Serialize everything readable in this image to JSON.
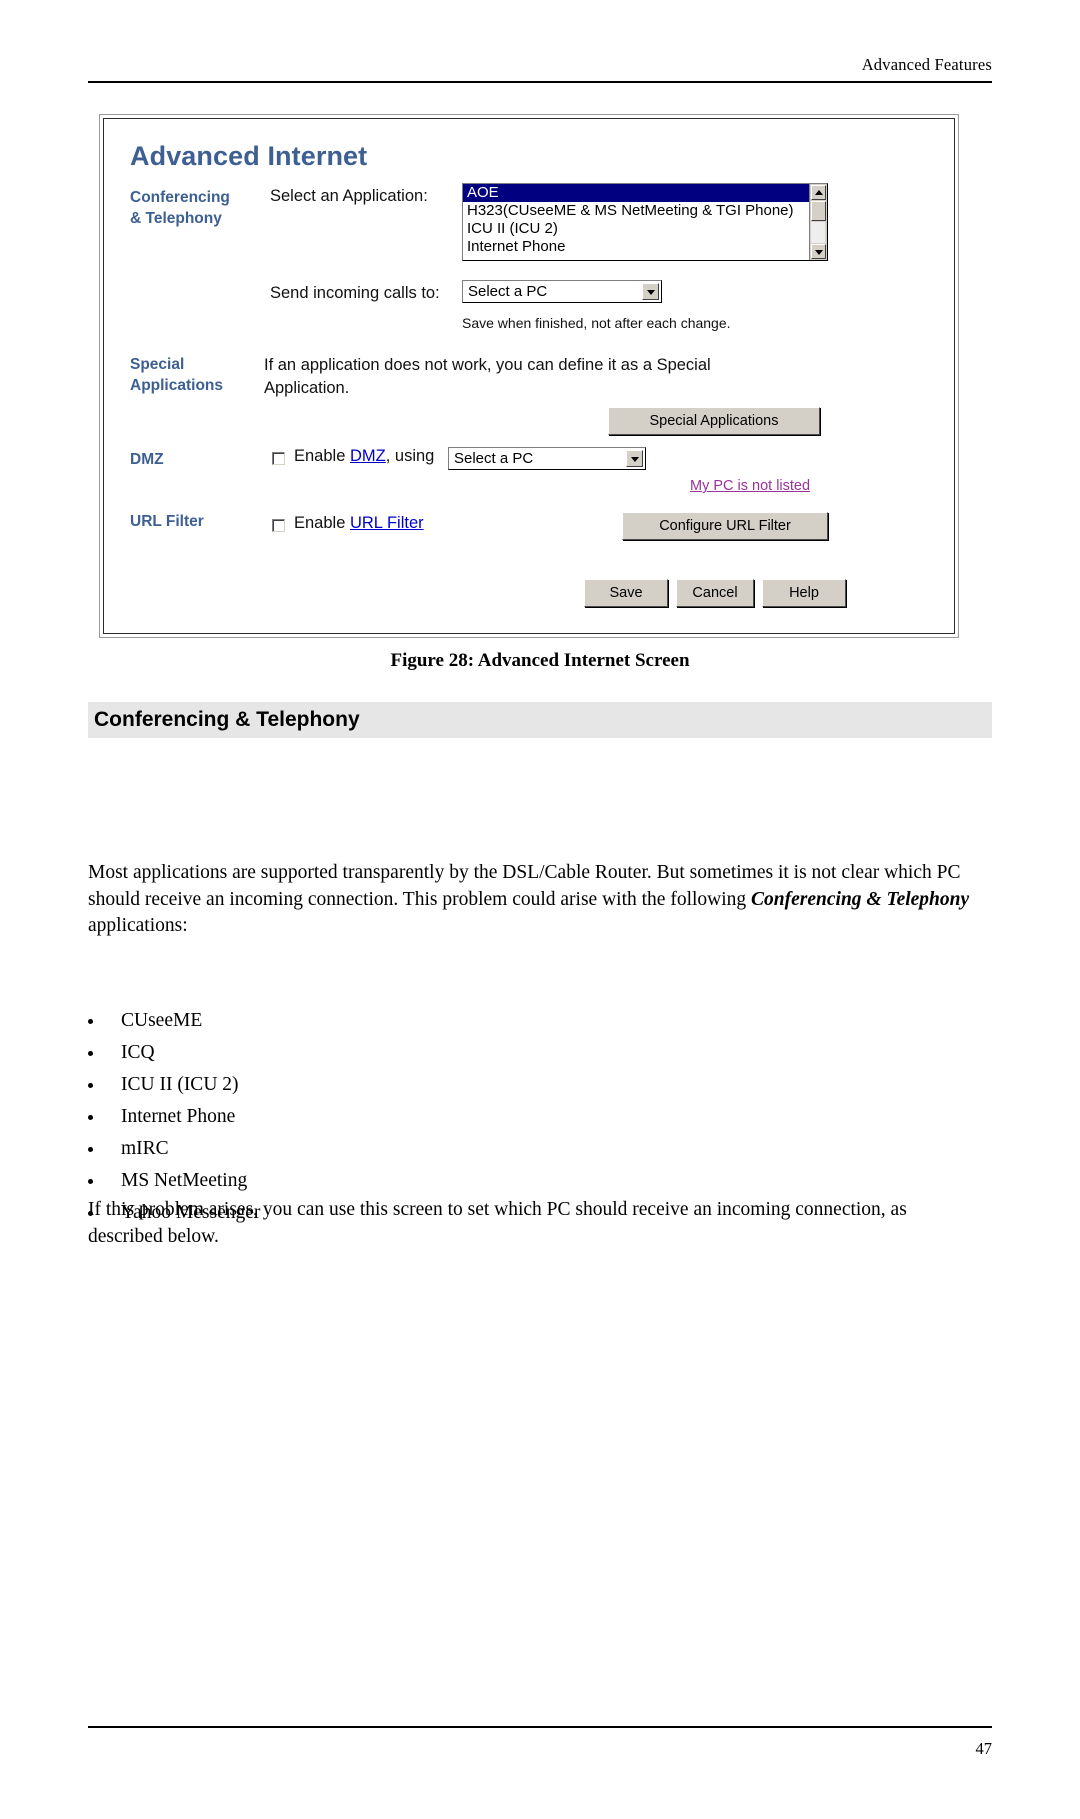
{
  "document": {
    "running_header": "Advanced Features",
    "page_number": "47",
    "figure_caption": "Figure 28: Advanced Internet Screen",
    "section_heading": "Conferencing & Telephony",
    "intro_paragraph_part1": "Most applications are supported transparently by the DSL/Cable Router. But sometimes it is not clear which PC should receive an incoming connection. This problem could arise with the following ",
    "intro_paragraph_emphasis": "Conferencing & Telephony",
    "intro_paragraph_part2": " applications:",
    "bullets": [
      "CUseeME",
      "ICQ",
      "ICU II (ICU 2)",
      "Internet Phone",
      "mIRC",
      "MS NetMeeting",
      "Yahoo Messenger"
    ],
    "closing_paragraph": "If this problem arises, you can use this screen to set which PC should receive an incoming connection, as described below."
  },
  "screenshot": {
    "title": "Advanced Internet",
    "accent_color": "#3d5f92",
    "sections": {
      "conferencing": {
        "label_line1": "Conferencing",
        "label_line2": "& Telephony",
        "select_application_label": "Select an Application:",
        "application_list": [
          "AOE",
          "H323(CUseeME & MS NetMeeting & TGI Phone)",
          "ICU II (ICU 2)",
          "Internet Phone"
        ],
        "selected_application": "AOE",
        "send_calls_label": "Send incoming calls to:",
        "send_calls_value": "Select a PC",
        "note": "Save when finished, not after each change."
      },
      "special_applications": {
        "label_line1": "Special",
        "label_line2": "Applications",
        "description_line1": "If an application does not work, you can define it as a Special",
        "description_line2": "Application.",
        "button_label": "Special Applications"
      },
      "dmz": {
        "label": "DMZ",
        "enable_prefix": "Enable ",
        "enable_link": "DMZ",
        "enable_suffix": ", using",
        "pc_value": "Select a PC",
        "not_listed_link": "My PC is not listed",
        "checked": false
      },
      "url_filter": {
        "label": "URL Filter",
        "enable_prefix": "Enable ",
        "enable_link": "URL Filter",
        "button_label": "Configure URL Filter",
        "checked": false
      }
    },
    "buttons": {
      "save": "Save",
      "cancel": "Cancel",
      "help": "Help"
    }
  }
}
